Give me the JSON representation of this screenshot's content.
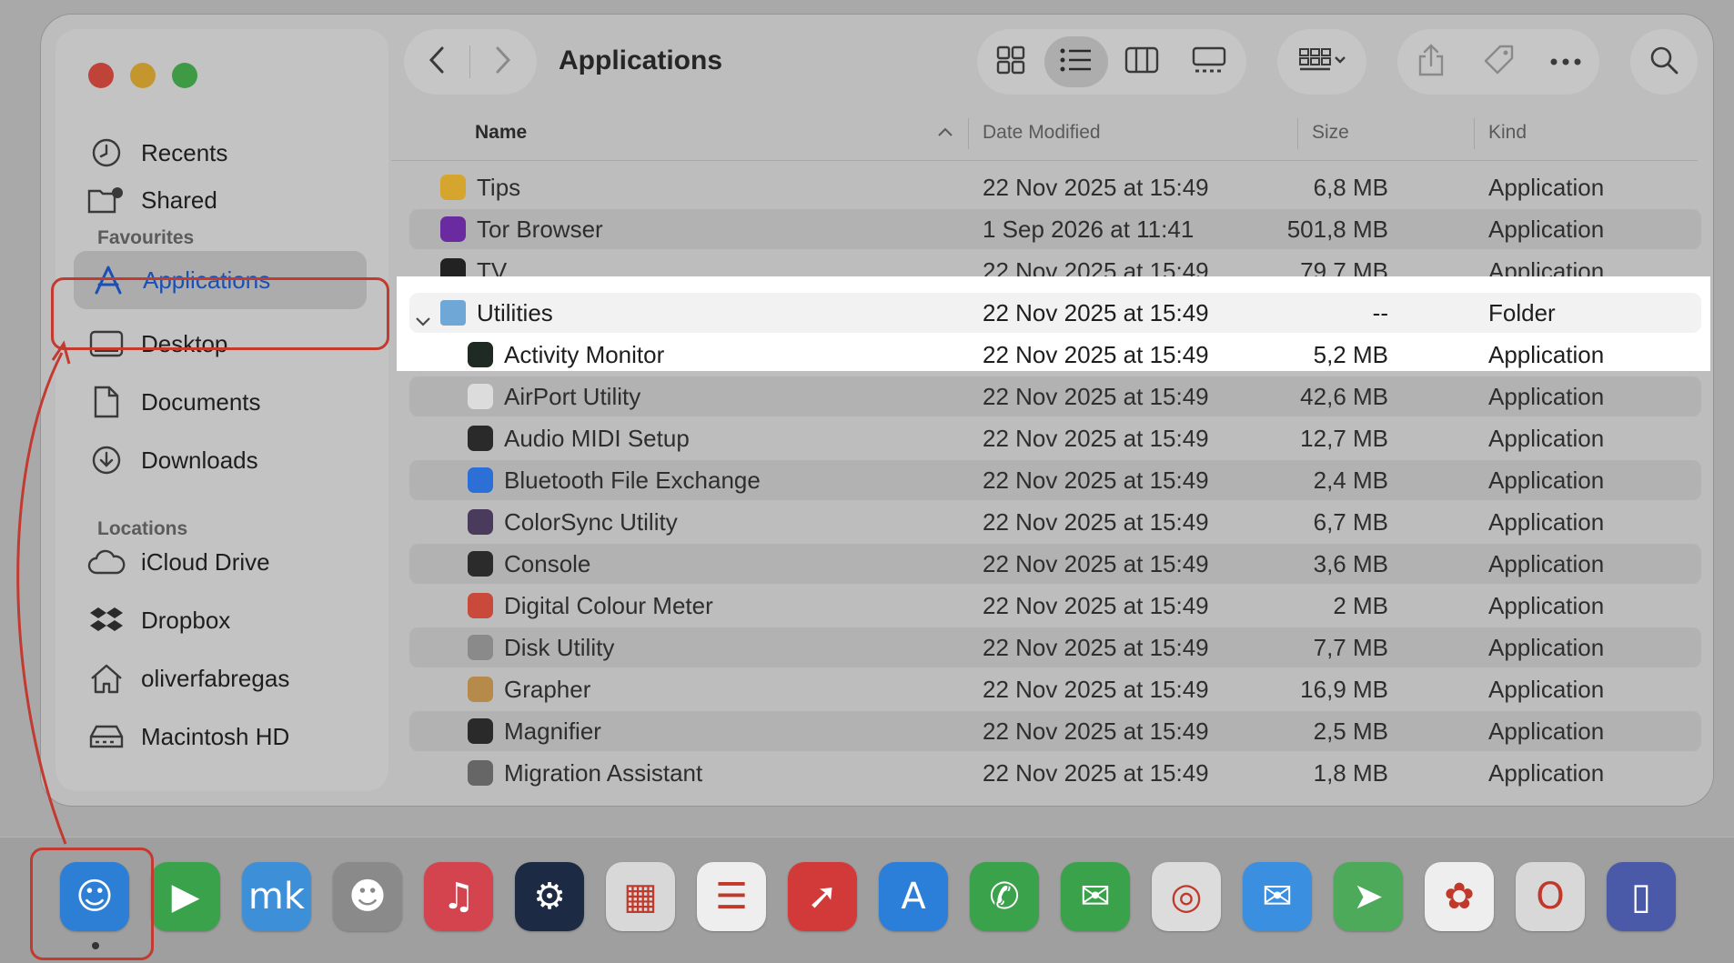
{
  "window": {
    "title": "Applications"
  },
  "sidebar": {
    "items_top": [
      {
        "label": "Recents",
        "icon": "clock-icon"
      },
      {
        "label": "Shared",
        "icon": "shared-folder-icon"
      }
    ],
    "favourites_header": "Favourites",
    "favourites": [
      {
        "label": "Applications",
        "icon": "app-store-a-icon",
        "active": true
      },
      {
        "label": "Desktop",
        "icon": "desktop-icon"
      },
      {
        "label": "Documents",
        "icon": "document-icon"
      },
      {
        "label": "Downloads",
        "icon": "download-icon"
      }
    ],
    "locations_header": "Locations",
    "locations": [
      {
        "label": "iCloud Drive",
        "icon": "cloud-icon"
      },
      {
        "label": "Dropbox",
        "icon": "dropbox-icon"
      },
      {
        "label": "oliverfabregas",
        "icon": "home-icon"
      },
      {
        "label": "Macintosh HD",
        "icon": "hard-drive-icon"
      }
    ]
  },
  "columns": {
    "name": "Name",
    "date": "Date Modified",
    "size": "Size",
    "kind": "Kind"
  },
  "files": [
    {
      "name": "Tips",
      "date": "22 Nov 2025 at 15:49",
      "size": "6,8 MB",
      "kind": "Application",
      "indent": 0,
      "color": "#d6a52d"
    },
    {
      "name": "Tor Browser",
      "date": "1 Sep 2026 at 11:41",
      "size": "501,8 MB",
      "kind": "Application",
      "indent": 0,
      "color": "#6a2aa0"
    },
    {
      "name": "TV",
      "date": "22 Nov 2025 at 15:49",
      "size": "79,7 MB",
      "kind": "Application",
      "indent": 0,
      "color": "#222222"
    },
    {
      "name": "Utilities",
      "date": "22 Nov 2025 at 15:49",
      "size": "--",
      "kind": "Folder",
      "indent": 0,
      "color": "#6fa8d6",
      "folder": true
    },
    {
      "name": "Activity Monitor",
      "date": "22 Nov 2025 at 15:49",
      "size": "5,2 MB",
      "kind": "Application",
      "indent": 1,
      "color": "#1f2a22"
    },
    {
      "name": "AirPort Utility",
      "date": "22 Nov 2025 at 15:49",
      "size": "42,6 MB",
      "kind": "Application",
      "indent": 1,
      "color": "#dcdcdc"
    },
    {
      "name": "Audio MIDI Setup",
      "date": "22 Nov 2025 at 15:49",
      "size": "12,7 MB",
      "kind": "Application",
      "indent": 1,
      "color": "#2a2a2a"
    },
    {
      "name": "Bluetooth File Exchange",
      "date": "22 Nov 2025 at 15:49",
      "size": "2,4 MB",
      "kind": "Application",
      "indent": 1,
      "color": "#2c6fd6"
    },
    {
      "name": "ColorSync Utility",
      "date": "22 Nov 2025 at 15:49",
      "size": "6,7 MB",
      "kind": "Application",
      "indent": 1,
      "color": "#4a3a5c"
    },
    {
      "name": "Console",
      "date": "22 Nov 2025 at 15:49",
      "size": "3,6 MB",
      "kind": "Application",
      "indent": 1,
      "color": "#2b2b2b"
    },
    {
      "name": "Digital Colour Meter",
      "date": "22 Nov 2025 at 15:49",
      "size": "2 MB",
      "kind": "Application",
      "indent": 1,
      "color": "#c94a3a"
    },
    {
      "name": "Disk Utility",
      "date": "22 Nov 2025 at 15:49",
      "size": "7,7 MB",
      "kind": "Application",
      "indent": 1,
      "color": "#8a8a8a"
    },
    {
      "name": "Grapher",
      "date": "22 Nov 2025 at 15:49",
      "size": "16,9 MB",
      "kind": "Application",
      "indent": 1,
      "color": "#b58a4a"
    },
    {
      "name": "Magnifier",
      "date": "22 Nov 2025 at 15:49",
      "size": "2,5 MB",
      "kind": "Application",
      "indent": 1,
      "color": "#2a2a2a"
    },
    {
      "name": "Migration Assistant",
      "date": "22 Nov 2025 at 15:49",
      "size": "1,8 MB",
      "kind": "Application",
      "indent": 1,
      "color": "#666666"
    }
  ],
  "dock": [
    {
      "name": "finder-icon",
      "color": "#2d7fd6",
      "glyph": "☺"
    },
    {
      "name": "facetime-icon",
      "color": "#3aa24a",
      "glyph": "▶"
    },
    {
      "name": "mk-app-icon",
      "color": "#3d8fd8",
      "glyph": "mk"
    },
    {
      "name": "contacts-icon",
      "color": "#8a8a8a",
      "glyph": "☻"
    },
    {
      "name": "music-icon",
      "color": "#d4444e",
      "glyph": "♫"
    },
    {
      "name": "steam-icon",
      "color": "#1c2a44",
      "glyph": "⚙"
    },
    {
      "name": "launchpad-icon",
      "color": "#d8d8d8",
      "glyph": "▦"
    },
    {
      "name": "reminders-icon",
      "color": "#eeeeee",
      "glyph": "☰"
    },
    {
      "name": "rocket-app-icon",
      "color": "#d23a3a",
      "glyph": "➚"
    },
    {
      "name": "app-store-icon",
      "color": "#2c7fd8",
      "glyph": "A"
    },
    {
      "name": "phone-icon",
      "color": "#3aa24a",
      "glyph": "✆"
    },
    {
      "name": "messages-icon",
      "color": "#3aa24a",
      "glyph": "✉"
    },
    {
      "name": "safari-icon",
      "color": "#dcdcdc",
      "glyph": "◎"
    },
    {
      "name": "mail-icon",
      "color": "#3a8fe0",
      "glyph": "✉"
    },
    {
      "name": "maps-icon",
      "color": "#4caa5a",
      "glyph": "➤"
    },
    {
      "name": "photos-icon",
      "color": "#eeeeee",
      "glyph": "✿"
    },
    {
      "name": "opera-icon",
      "color": "#d8d8d8",
      "glyph": "O"
    },
    {
      "name": "simulator-icon",
      "color": "#4a5aa8",
      "glyph": "▯"
    }
  ],
  "accent": "#1a4fb5",
  "annotation_color": "#c23a30"
}
